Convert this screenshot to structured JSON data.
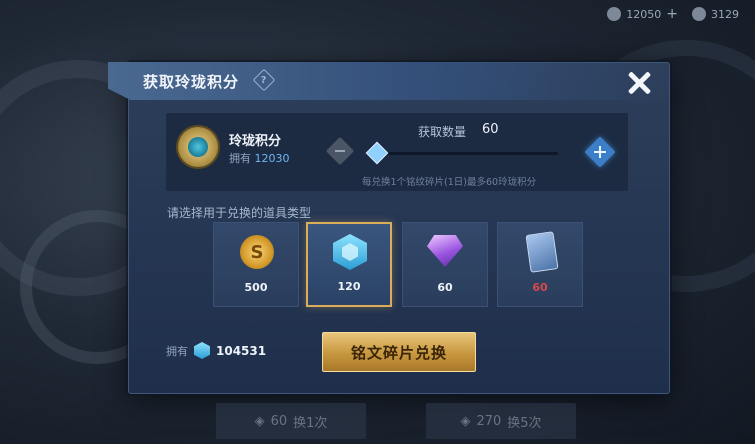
{
  "topbar": {
    "resource1_value": "12050",
    "resource2_value": "3129"
  },
  "dialog": {
    "title": "获取玲珑积分",
    "help_icon": "?",
    "currency": {
      "name": "玲珑积分",
      "owned_label": "拥有",
      "owned_value": "12030"
    },
    "quantity": {
      "label": "获取数量",
      "value": "60",
      "hint": "每兑换1个铭纹碎片(1日)最多60玲珑积分"
    },
    "choose_label": "请选择用于兑换的道具类型",
    "items": [
      {
        "icon": "gold-coin-icon",
        "qty": "500",
        "selected": false
      },
      {
        "icon": "crystal-icon",
        "qty": "120",
        "selected": true
      },
      {
        "icon": "gem-icon",
        "qty": "60",
        "selected": false
      },
      {
        "icon": "card-icon",
        "qty": "60",
        "selected": false
      }
    ],
    "bottom_owned_label": "拥有",
    "bottom_owned_value": "104531",
    "exchange_button": "铭文碎片兑换"
  },
  "under_buttons": [
    {
      "value": "60",
      "label": "换1次"
    },
    {
      "value": "270",
      "label": "换5次"
    }
  ],
  "colors": {
    "accent_gold": "#d9ad5a",
    "accent_blue": "#5aa6e6",
    "warning_red": "#d64a4a"
  }
}
